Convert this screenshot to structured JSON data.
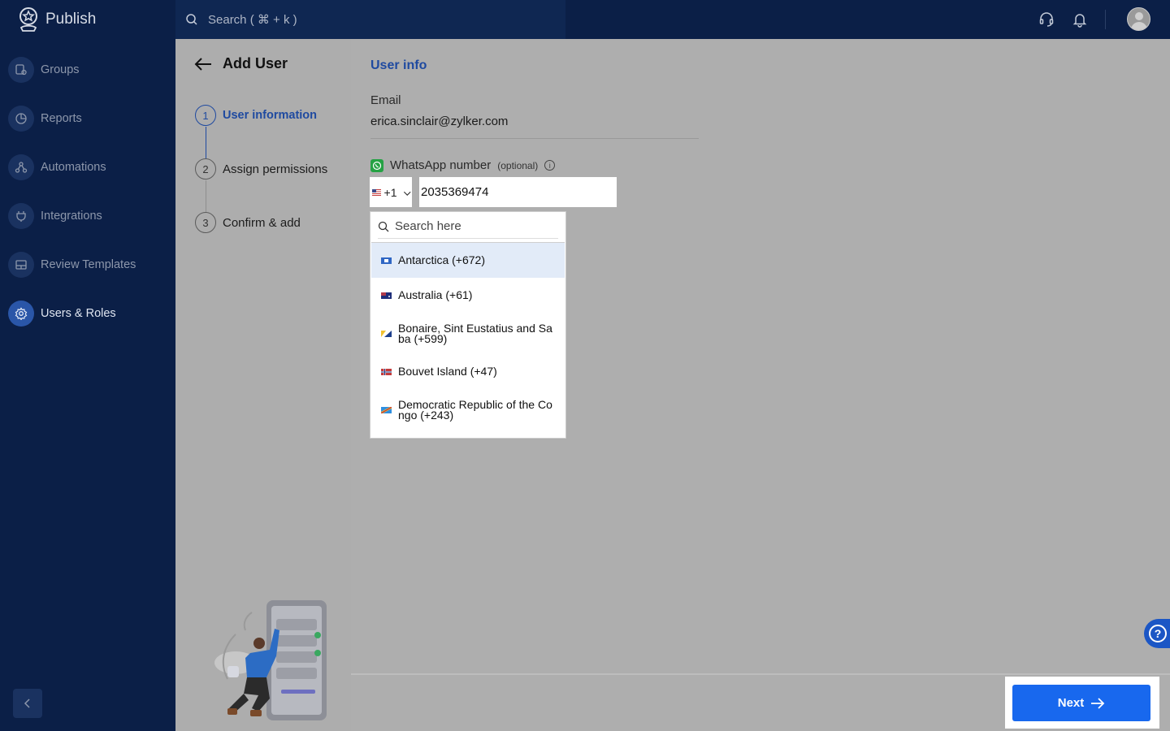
{
  "app": {
    "name": "Publish"
  },
  "search": {
    "placeholder": "Search ( ⌘ + k )"
  },
  "sidebar": {
    "items": [
      {
        "label": "Groups",
        "icon": "groups-icon"
      },
      {
        "label": "Reports",
        "icon": "reports-icon"
      },
      {
        "label": "Automations",
        "icon": "automations-icon"
      },
      {
        "label": "Integrations",
        "icon": "integrations-icon"
      },
      {
        "label": "Review Templates",
        "icon": "review-templates-icon"
      },
      {
        "label": "Users & Roles",
        "icon": "users-roles-icon",
        "active": true
      }
    ]
  },
  "wizard": {
    "title": "Add User",
    "steps": [
      {
        "num": "1",
        "label": "User information",
        "active": true
      },
      {
        "num": "2",
        "label": "Assign permissions"
      },
      {
        "num": "3",
        "label": "Confirm & add"
      }
    ]
  },
  "form": {
    "section_title": "User info",
    "email_label": "Email",
    "email_value": "erica.sinclair@zylker.com",
    "whatsapp_label": "WhatsApp number",
    "whatsapp_optional": "(optional)",
    "country_code": "+1",
    "phone_value": "2035369474"
  },
  "country_dropdown": {
    "search_placeholder": "Search here",
    "items": [
      {
        "label": "Antarctica (+672)",
        "highlighted": true
      },
      {
        "label": "Australia (+61)"
      },
      {
        "label": "Bonaire, Sint Eustatius and Saba (+599)"
      },
      {
        "label": "Bouvet Island (+47)"
      },
      {
        "label": "Democratic Republic of the Congo (+243)"
      }
    ]
  },
  "footer": {
    "next_label": "Next"
  },
  "colors": {
    "navy": "#0b1f47",
    "accent": "#1868ee",
    "link_blue": "#1f4aa0"
  }
}
